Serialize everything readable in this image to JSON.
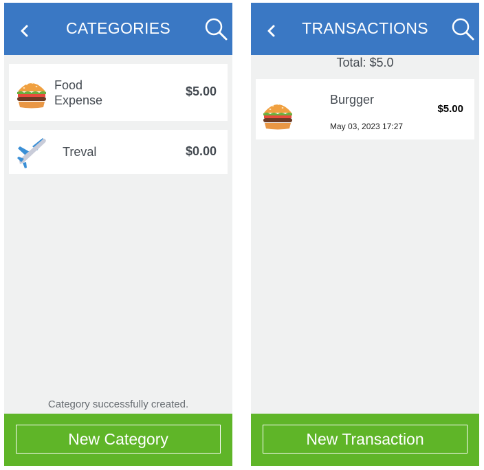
{
  "categories_screen": {
    "title": "CATEGORIES",
    "items": [
      {
        "icon": "burger-icon",
        "name_line1": "Food",
        "name_line2": "Expense",
        "amount": "$5.00"
      },
      {
        "icon": "airplane-icon",
        "name": "Treval",
        "amount": "$0.00"
      }
    ],
    "toast": "Category successfully created.",
    "new_button_label": "New Category"
  },
  "transactions_screen": {
    "title": "TRANSACTIONS",
    "total": "Total: $5.0",
    "items": [
      {
        "icon": "burger-icon",
        "name": "Burgger",
        "date": "May 03, 2023 17:27",
        "amount": "$5.00"
      }
    ],
    "new_button_label": "New Transaction"
  },
  "colors": {
    "header_blue": "#3a78c4",
    "footer_green": "#5fb528",
    "background": "#f0f1f1",
    "text": "#444a51"
  }
}
